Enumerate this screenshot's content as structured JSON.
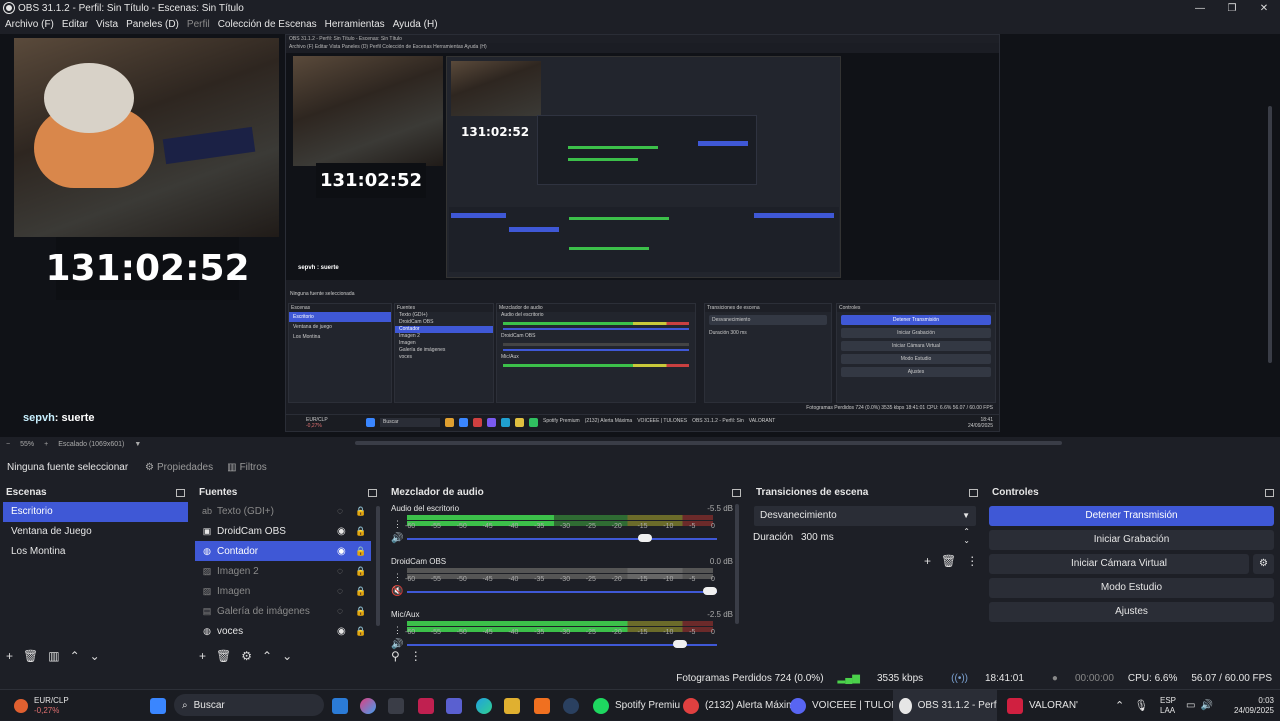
{
  "window": {
    "title": "OBS 31.1.2 - Perfil: Sin Título - Escenas: Sin Título",
    "minimize": "—",
    "maximize": "❐",
    "close": "✕"
  },
  "menu": {
    "items": [
      "Archivo (F)",
      "Editar",
      "Vista",
      "Paneles (D)",
      "Perfil",
      "Colección de Escenas",
      "Herramientas",
      "Ayuda (H)"
    ]
  },
  "preview": {
    "counter": "131:02:52",
    "chat_user": "sepvh",
    "chat_message": ": suerte",
    "inner": {
      "title": "OBS 31.1.2 - Perfil: Sin Título - Escenas: Sin Título",
      "menu": "Archivo (F)   Editar   Vista   Paneles (D)   Perfil   Colección de Escenas   Herramientas   Ayuda (H)",
      "counter": "131:02:52",
      "mini_counter": "131:02:52",
      "chat": "sepvh : suerte",
      "no_source": "Ninguna fuente seleccionada",
      "scenes_title": "Escenas",
      "scenes": [
        "Escritorio",
        "Ventana de juego",
        "Los Montina"
      ],
      "sources_title": "Fuentes",
      "sources": [
        "Texto (GDI+)",
        "DroidCam OBS",
        "Contador",
        "Imagen 2",
        "Imagen",
        "Galería de imágenes",
        "voces"
      ],
      "mixer_title": "Mezclador de audio",
      "mixer_channels": [
        "Audio del escritorio",
        "DroidCam OBS",
        "Mic/Aux"
      ],
      "transitions_title": "Transiciones de escena",
      "transition": "Desvanecimiento",
      "duration_label": "Duración",
      "duration": "300 ms",
      "controls_title": "Controles",
      "controls": [
        "Detener Transmisión",
        "Iniciar Grabación",
        "Iniciar Cámara Virtual",
        "Modo Estudio",
        "Ajustes"
      ],
      "status": "Fotogramas Perdidos 724 (0.0%)   3535 kbps   18:41:01   CPU: 6.6%   56.07 / 60.00 FPS",
      "taskbar_search": "Buscar",
      "taskbar_spotify": "Spotify Premium",
      "taskbar_alert": "(2132) Alerta Máxima",
      "taskbar_voice": "VOICEEE | TULONES",
      "taskbar_obs": "OBS 31.1.2 - Perfil: Sin",
      "taskbar_valorant": "VALORANT",
      "taskbar_stock": "EUR/CLP",
      "taskbar_stock_change": "-0,27%",
      "time": "18:41",
      "date": "24/09/2025"
    }
  },
  "zoom": {
    "minus": "−",
    "level": "55%",
    "plus": "+",
    "scaling": "Escalado (1069x601)",
    "dropdown": "▼"
  },
  "source_toolbar": {
    "none_selected": "Ninguna fuente seleccionar",
    "properties": "Propiedades",
    "filters": "Filtros"
  },
  "scenes": {
    "title": "Escenas",
    "items": [
      {
        "label": "Escritorio",
        "selected": true
      },
      {
        "label": "Ventana de Juego",
        "selected": false
      },
      {
        "label": "Los Montina",
        "selected": false
      }
    ]
  },
  "sources": {
    "title": "Fuentes",
    "items": [
      {
        "label": "Texto (GDI+)",
        "icon": "text-icon",
        "glyph": "ab",
        "visible": false,
        "selected": false
      },
      {
        "label": "DroidCam OBS",
        "icon": "camera-icon",
        "glyph": "▣",
        "visible": true,
        "selected": false
      },
      {
        "label": "Contador",
        "icon": "browser-icon",
        "glyph": "◍",
        "visible": true,
        "selected": true
      },
      {
        "label": "Imagen 2",
        "icon": "image-icon",
        "glyph": "▨",
        "visible": false,
        "selected": false
      },
      {
        "label": "Imagen",
        "icon": "image-icon",
        "glyph": "▨",
        "visible": false,
        "selected": false
      },
      {
        "label": "Galería de imágenes",
        "icon": "gallery-icon",
        "glyph": "▤",
        "visible": false,
        "selected": false
      },
      {
        "label": "voces",
        "icon": "browser-icon",
        "glyph": "◍",
        "visible": true,
        "selected": false
      }
    ]
  },
  "mixer": {
    "title": "Mezclador de audio",
    "scale": [
      "-60",
      "-55",
      "-50",
      "-45",
      "-40",
      "-35",
      "-30",
      "-25",
      "-20",
      "-15",
      "-10",
      "-5",
      "0"
    ],
    "channels": [
      {
        "name": "Audio del escritorio",
        "db": "-5.5 dB",
        "level": 0.48,
        "fader": 0.78,
        "muted": false,
        "meter_active": true
      },
      {
        "name": "DroidCam OBS",
        "db": "0.0 dB",
        "level": 0.0,
        "fader": 1.0,
        "muted": true,
        "meter_active": false
      },
      {
        "name": "Mic/Aux",
        "db": "-2.5 dB",
        "level": 0.72,
        "fader": 0.9,
        "muted": false,
        "meter_active": true
      }
    ]
  },
  "transitions": {
    "title": "Transiciones de escena",
    "selected": "Desvanecimiento",
    "duration_label": "Duración",
    "duration_value": "300 ms"
  },
  "controls": {
    "title": "Controles",
    "stop_stream": "Detener Transmisión",
    "start_recording": "Iniciar Grabación",
    "start_virtual_cam": "Iniciar Cámara Virtual",
    "studio_mode": "Modo Estudio",
    "settings": "Ajustes"
  },
  "status": {
    "dropped_frames": "Fotogramas Perdidos 724 (0.0%)",
    "bitrate": "3535 kbps",
    "stream_time": "18:41:01",
    "rec_time": "00:00:00",
    "cpu": "CPU: 6.6%",
    "fps": "56.07 / 60.00 FPS"
  },
  "taskbar": {
    "stock_name": "EUR/CLP",
    "stock_change": "-0,27%",
    "search": "Buscar",
    "spotify": "Spotify Premiu",
    "alert": "(2132) Alerta Máxima",
    "voiceee": "VOICEEE | TULONES '",
    "obs": "OBS 31.1.2 - Perfil: Sir",
    "valorant": "VALORAN'",
    "lang1": "ESP",
    "lang2": "LAA",
    "time": "0:03",
    "date": "24/09/2025"
  },
  "colors": {
    "accent": "#3f58d6",
    "meter_green": "#3cc04a",
    "meter_yellow": "#c9c93a",
    "meter_red": "#c94040"
  }
}
